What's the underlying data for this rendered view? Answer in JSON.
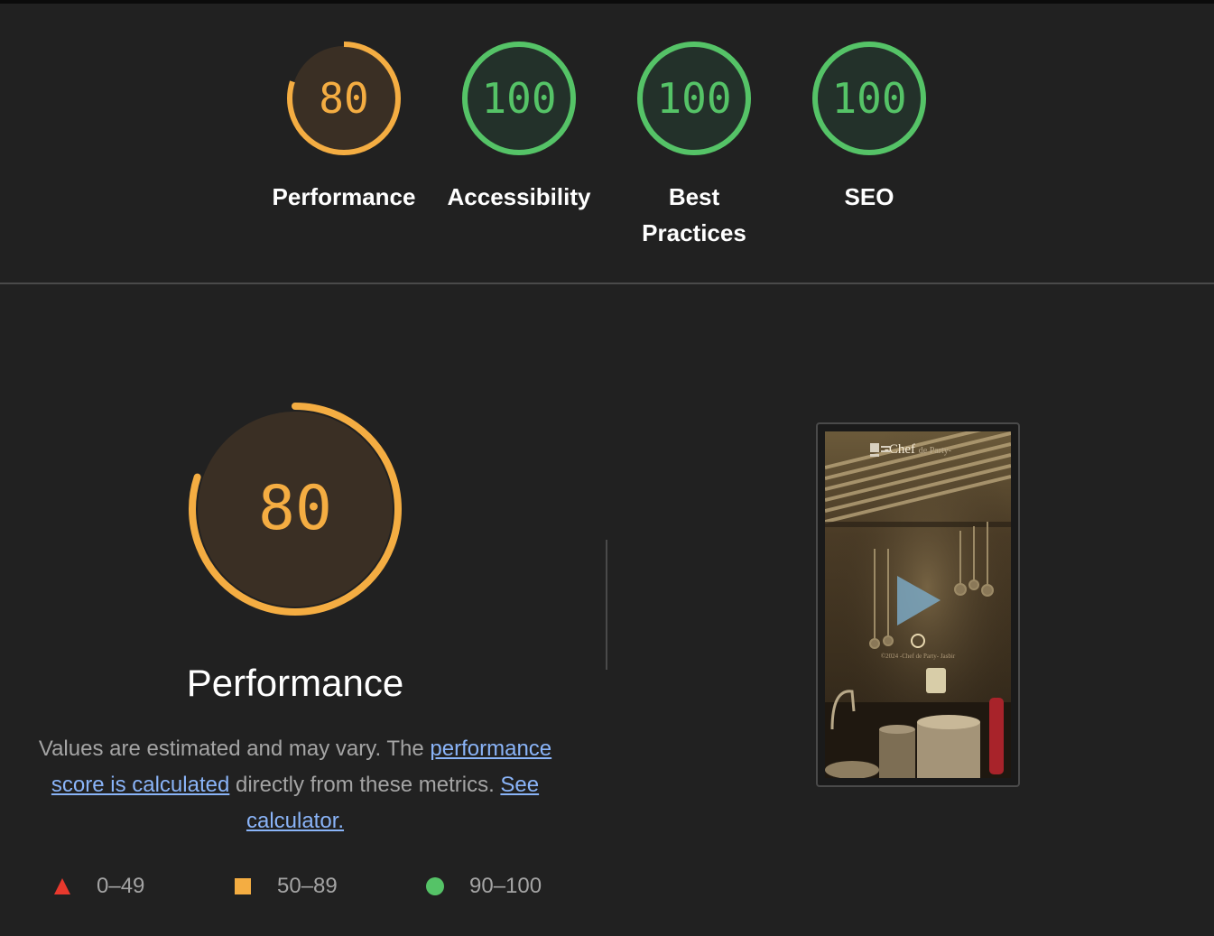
{
  "colors": {
    "average": "#f4ad42",
    "pass": "#55c367",
    "fail": "#e8392d",
    "average_bg": "#3a2f24",
    "pass_bg": "#23312a",
    "link": "#8ab4f8"
  },
  "summary": [
    {
      "score": "80",
      "label": "Performance",
      "rating": "average"
    },
    {
      "score": "100",
      "label": "Accessibility",
      "rating": "pass"
    },
    {
      "score": "100",
      "label": "Best Practices",
      "rating": "pass"
    },
    {
      "score": "100",
      "label": "SEO",
      "rating": "pass"
    }
  ],
  "performance": {
    "score": "80",
    "title": "Performance",
    "description": {
      "text1": "Values are estimated and may vary. The ",
      "link1": "performance score is calculated",
      "text2": " directly from these metrics. ",
      "link2": "See calculator."
    }
  },
  "legend": [
    {
      "range": "0–49",
      "icon": "triangle-icon"
    },
    {
      "range": "50–89",
      "icon": "square-icon"
    },
    {
      "range": "90–100",
      "icon": "circle-icon"
    }
  ],
  "screenshot": {
    "brand_main": "-Chef",
    "brand_small": "de Party-",
    "footer": "©2024 -Chef de Party- Jasbir"
  }
}
